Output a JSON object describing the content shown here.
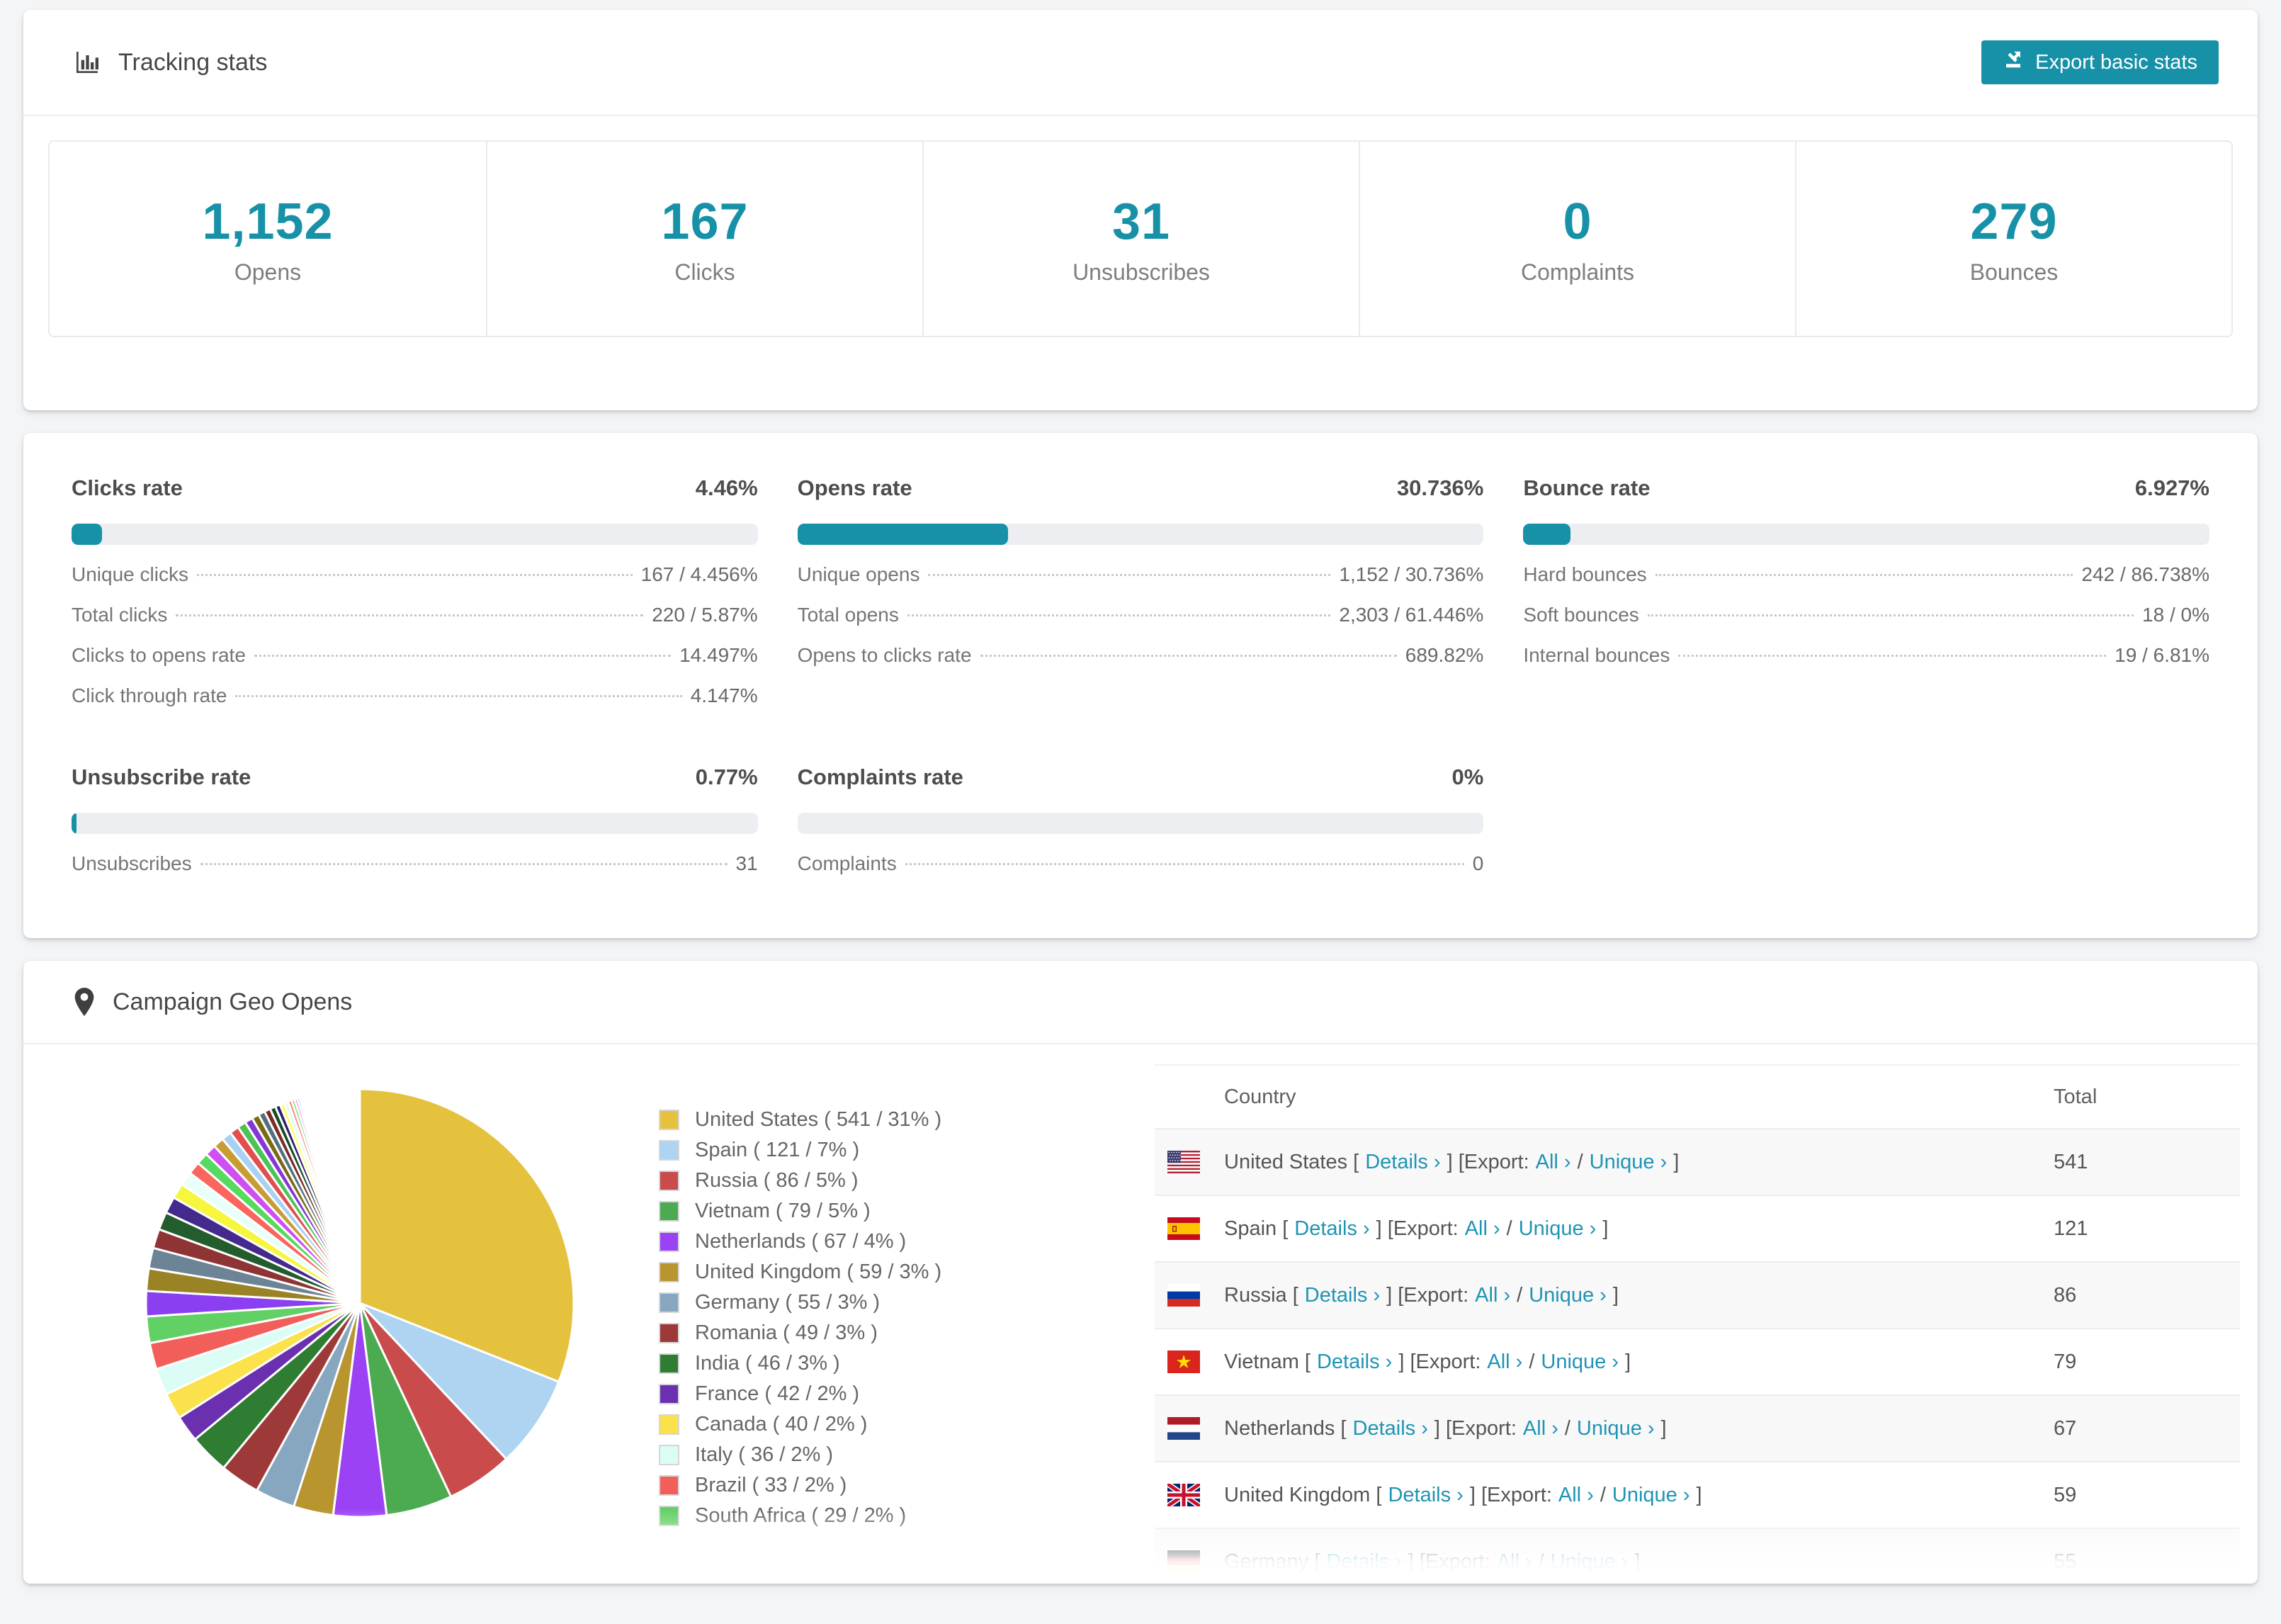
{
  "colors": {
    "accent": "#1791a7",
    "link": "#1f94b4"
  },
  "tracking": {
    "title": "Tracking stats",
    "export_button": "Export basic stats"
  },
  "summary": [
    {
      "value": "1,152",
      "label": "Opens"
    },
    {
      "value": "167",
      "label": "Clicks"
    },
    {
      "value": "31",
      "label": "Unsubscribes"
    },
    {
      "value": "0",
      "label": "Complaints"
    },
    {
      "value": "279",
      "label": "Bounces"
    }
  ],
  "rates": [
    {
      "title": "Clicks rate",
      "value": "4.46%",
      "pct": 4.46,
      "rows": [
        {
          "label": "Unique clicks",
          "value": "167 / 4.456%"
        },
        {
          "label": "Total clicks",
          "value": "220 / 5.87%"
        },
        {
          "label": "Clicks to opens rate",
          "value": "14.497%"
        },
        {
          "label": "Click through rate",
          "value": "4.147%"
        }
      ]
    },
    {
      "title": "Opens rate",
      "value": "30.736%",
      "pct": 30.736,
      "rows": [
        {
          "label": "Unique opens",
          "value": "1,152 / 30.736%"
        },
        {
          "label": "Total opens",
          "value": "2,303 / 61.446%"
        },
        {
          "label": "Opens to clicks rate",
          "value": "689.82%"
        }
      ]
    },
    {
      "title": "Bounce rate",
      "value": "6.927%",
      "pct": 6.927,
      "rows": [
        {
          "label": "Hard bounces",
          "value": "242 / 86.738%"
        },
        {
          "label": "Soft bounces",
          "value": "18 / 0%"
        },
        {
          "label": "Internal bounces",
          "value": "19 / 6.81%"
        }
      ]
    },
    {
      "title": "Unsubscribe rate",
      "value": "0.77%",
      "pct": 0.77,
      "rows": [
        {
          "label": "Unsubscribes",
          "value": "31"
        }
      ]
    },
    {
      "title": "Complaints rate",
      "value": "0%",
      "pct": 0,
      "rows": [
        {
          "label": "Complaints",
          "value": "0"
        }
      ]
    }
  ],
  "geo": {
    "title": "Campaign Geo Opens",
    "chart_data": {
      "type": "pie",
      "title": "Campaign Geo Opens",
      "legend_position": "right",
      "slices": [
        {
          "label": "United States",
          "value": 541,
          "pct": 31,
          "color": "#e5c23d"
        },
        {
          "label": "Spain",
          "value": 121,
          "pct": 7,
          "color": "#aed4f2"
        },
        {
          "label": "Russia",
          "value": 86,
          "pct": 5,
          "color": "#c94b4b"
        },
        {
          "label": "Vietnam",
          "value": 79,
          "pct": 5,
          "color": "#4cab51"
        },
        {
          "label": "Netherlands",
          "value": 67,
          "pct": 4,
          "color": "#9b42f5"
        },
        {
          "label": "United Kingdom",
          "value": 59,
          "pct": 3,
          "color": "#b8952e"
        },
        {
          "label": "Germany",
          "value": 55,
          "pct": 3,
          "color": "#87a7c1"
        },
        {
          "label": "Romania",
          "value": 49,
          "pct": 3,
          "color": "#9e3939"
        },
        {
          "label": "India",
          "value": 46,
          "pct": 3,
          "color": "#2e7d32"
        },
        {
          "label": "France",
          "value": 42,
          "pct": 2,
          "color": "#6a30b0"
        },
        {
          "label": "Canada",
          "value": 40,
          "pct": 2,
          "color": "#fbe14b"
        },
        {
          "label": "Italy",
          "value": 36,
          "pct": 2,
          "color": "#dcfcf6"
        },
        {
          "label": "Brazil",
          "value": 33,
          "pct": 2,
          "color": "#f25f5a"
        },
        {
          "label": "South Africa",
          "value": 29,
          "pct": 2,
          "color": "#61d065"
        }
      ],
      "tail": {
        "pcts": [
          1.9,
          1.7,
          1.55,
          1.45,
          1.35,
          1.25,
          1.15,
          1.05,
          0.95,
          0.9,
          0.85,
          0.8,
          0.75,
          0.7,
          0.65,
          0.6,
          0.55,
          0.5,
          0.46,
          0.42,
          0.38,
          0.34,
          0.3,
          0.27,
          0.24,
          0.21,
          0.18,
          0.16,
          0.14,
          0.12,
          0.1,
          0.09,
          0.08,
          0.07,
          0.06,
          0.05,
          0.045,
          0.04,
          0.035,
          0.03
        ],
        "colors": [
          "#8a3ff0",
          "#9a8325",
          "#6c8495",
          "#8e3434",
          "#235c2d",
          "#432a8c",
          "#f6f63f",
          "#e8fffa",
          "#fa655e",
          "#58d95f",
          "#cf4ff2",
          "#c79d33",
          "#a9d1f2",
          "#e14f4f",
          "#4cc353",
          "#8438d8",
          "#7a6a14",
          "#53707f",
          "#7c2a2a",
          "#174d24",
          "#2f1f6e",
          "#ffff66",
          "#d7fff8",
          "#ff7a70",
          "#66e06a",
          "#e06df5"
        ]
      }
    },
    "legend_format": {
      "open": "( ",
      "mid": " / ",
      "close": "% )"
    },
    "table": {
      "headers": [
        "Country",
        "Total"
      ],
      "links": {
        "details": "Details ›",
        "bracket_open": "[",
        "bracket_close": "]",
        "export_label": "Export:",
        "all": "All ›",
        "slash": "/",
        "unique": "Unique ›"
      },
      "rows": [
        {
          "country": "United States",
          "flag": "us",
          "total": "541"
        },
        {
          "country": "Spain",
          "flag": "es",
          "total": "121"
        },
        {
          "country": "Russia",
          "flag": "ru",
          "total": "86"
        },
        {
          "country": "Vietnam",
          "flag": "vn",
          "total": "79"
        },
        {
          "country": "Netherlands",
          "flag": "nl",
          "total": "67"
        },
        {
          "country": "United Kingdom",
          "flag": "gb",
          "total": "59"
        },
        {
          "country": "Germany",
          "flag": "de",
          "total": "55",
          "partial": true
        }
      ]
    }
  }
}
